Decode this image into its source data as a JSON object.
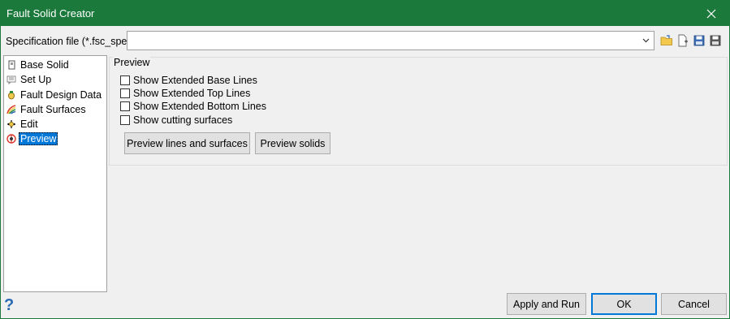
{
  "window": {
    "title": "Fault Solid Creator"
  },
  "spec": {
    "label": "Specification file (*.fsc_spec)",
    "value": ""
  },
  "toolbar": {
    "icons": [
      "open-folder-icon",
      "new-file-icon",
      "save-icon",
      "save-as-icon"
    ]
  },
  "tree": {
    "items": [
      {
        "label": "Base Solid",
        "icon": "base-solid-icon"
      },
      {
        "label": "Set Up",
        "icon": "set-up-icon"
      },
      {
        "label": "Fault Design Data",
        "icon": "fault-design-data-icon"
      },
      {
        "label": "Fault Surfaces",
        "icon": "fault-surfaces-icon"
      },
      {
        "label": "Edit",
        "icon": "edit-icon"
      },
      {
        "label": "Preview",
        "icon": "preview-icon",
        "selected": true
      }
    ]
  },
  "preview": {
    "title": "Preview",
    "checkboxes": [
      {
        "label": "Show Extended Base Lines",
        "checked": false
      },
      {
        "label": "Show Extended Top Lines",
        "checked": false
      },
      {
        "label": "Show Extended Bottom Lines",
        "checked": false
      },
      {
        "label": "Show cutting surfaces",
        "checked": false
      }
    ],
    "buttons": {
      "lines_surfaces": "Preview lines and surfaces",
      "solids": "Preview solids"
    }
  },
  "footer": {
    "apply_run": "Apply and Run",
    "ok": "OK",
    "cancel": "Cancel"
  },
  "colors": {
    "titlebar": "#1b7a3b",
    "selection": "#0078d7",
    "dialog_bg": "#f0f0f0"
  }
}
